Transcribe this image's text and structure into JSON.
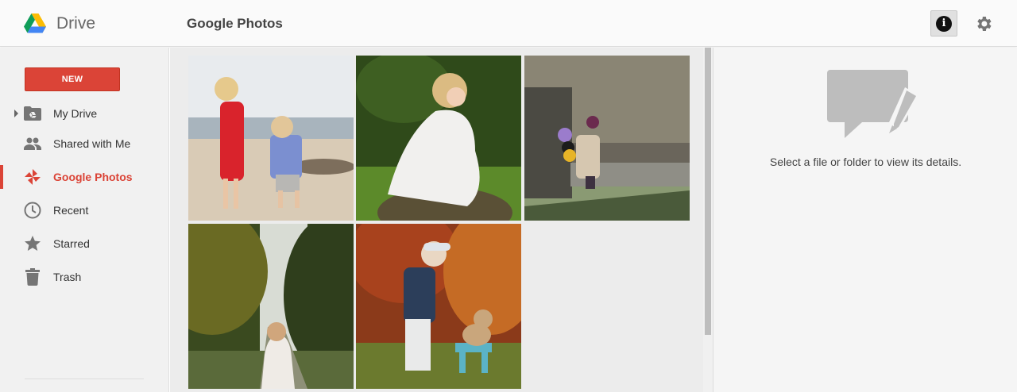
{
  "header": {
    "app_name": "Drive",
    "page_title": "Google Photos",
    "icons": [
      "drive-logo",
      "info-icon",
      "gear-icon"
    ]
  },
  "sidebar": {
    "new_button": "NEW",
    "items": [
      {
        "label": "My Drive",
        "icon": "drive-folder-icon",
        "expandable": true
      },
      {
        "label": "Shared with Me",
        "icon": "people-icon"
      },
      {
        "label": "Google Photos",
        "icon": "pinwheel-icon",
        "active": true
      },
      {
        "label": "Recent",
        "icon": "clock-icon"
      },
      {
        "label": "Starred",
        "icon": "star-icon"
      },
      {
        "label": "Trash",
        "icon": "trash-icon"
      }
    ]
  },
  "photos": [
    {
      "subject": "girl in red dress and boy on beach"
    },
    {
      "subject": "girl in white dress sitting on rock"
    },
    {
      "subject": "child with balloons in snow"
    },
    {
      "subject": "girl in white dress on forest path"
    },
    {
      "subject": "boy in cap with teddy bear on blue stool"
    }
  ],
  "details": {
    "empty_message": "Select a file or folder to view its details."
  },
  "colors": {
    "accent": "#db4437",
    "sidebar_bg": "#f1f1f1",
    "content_bg": "#ececec"
  }
}
